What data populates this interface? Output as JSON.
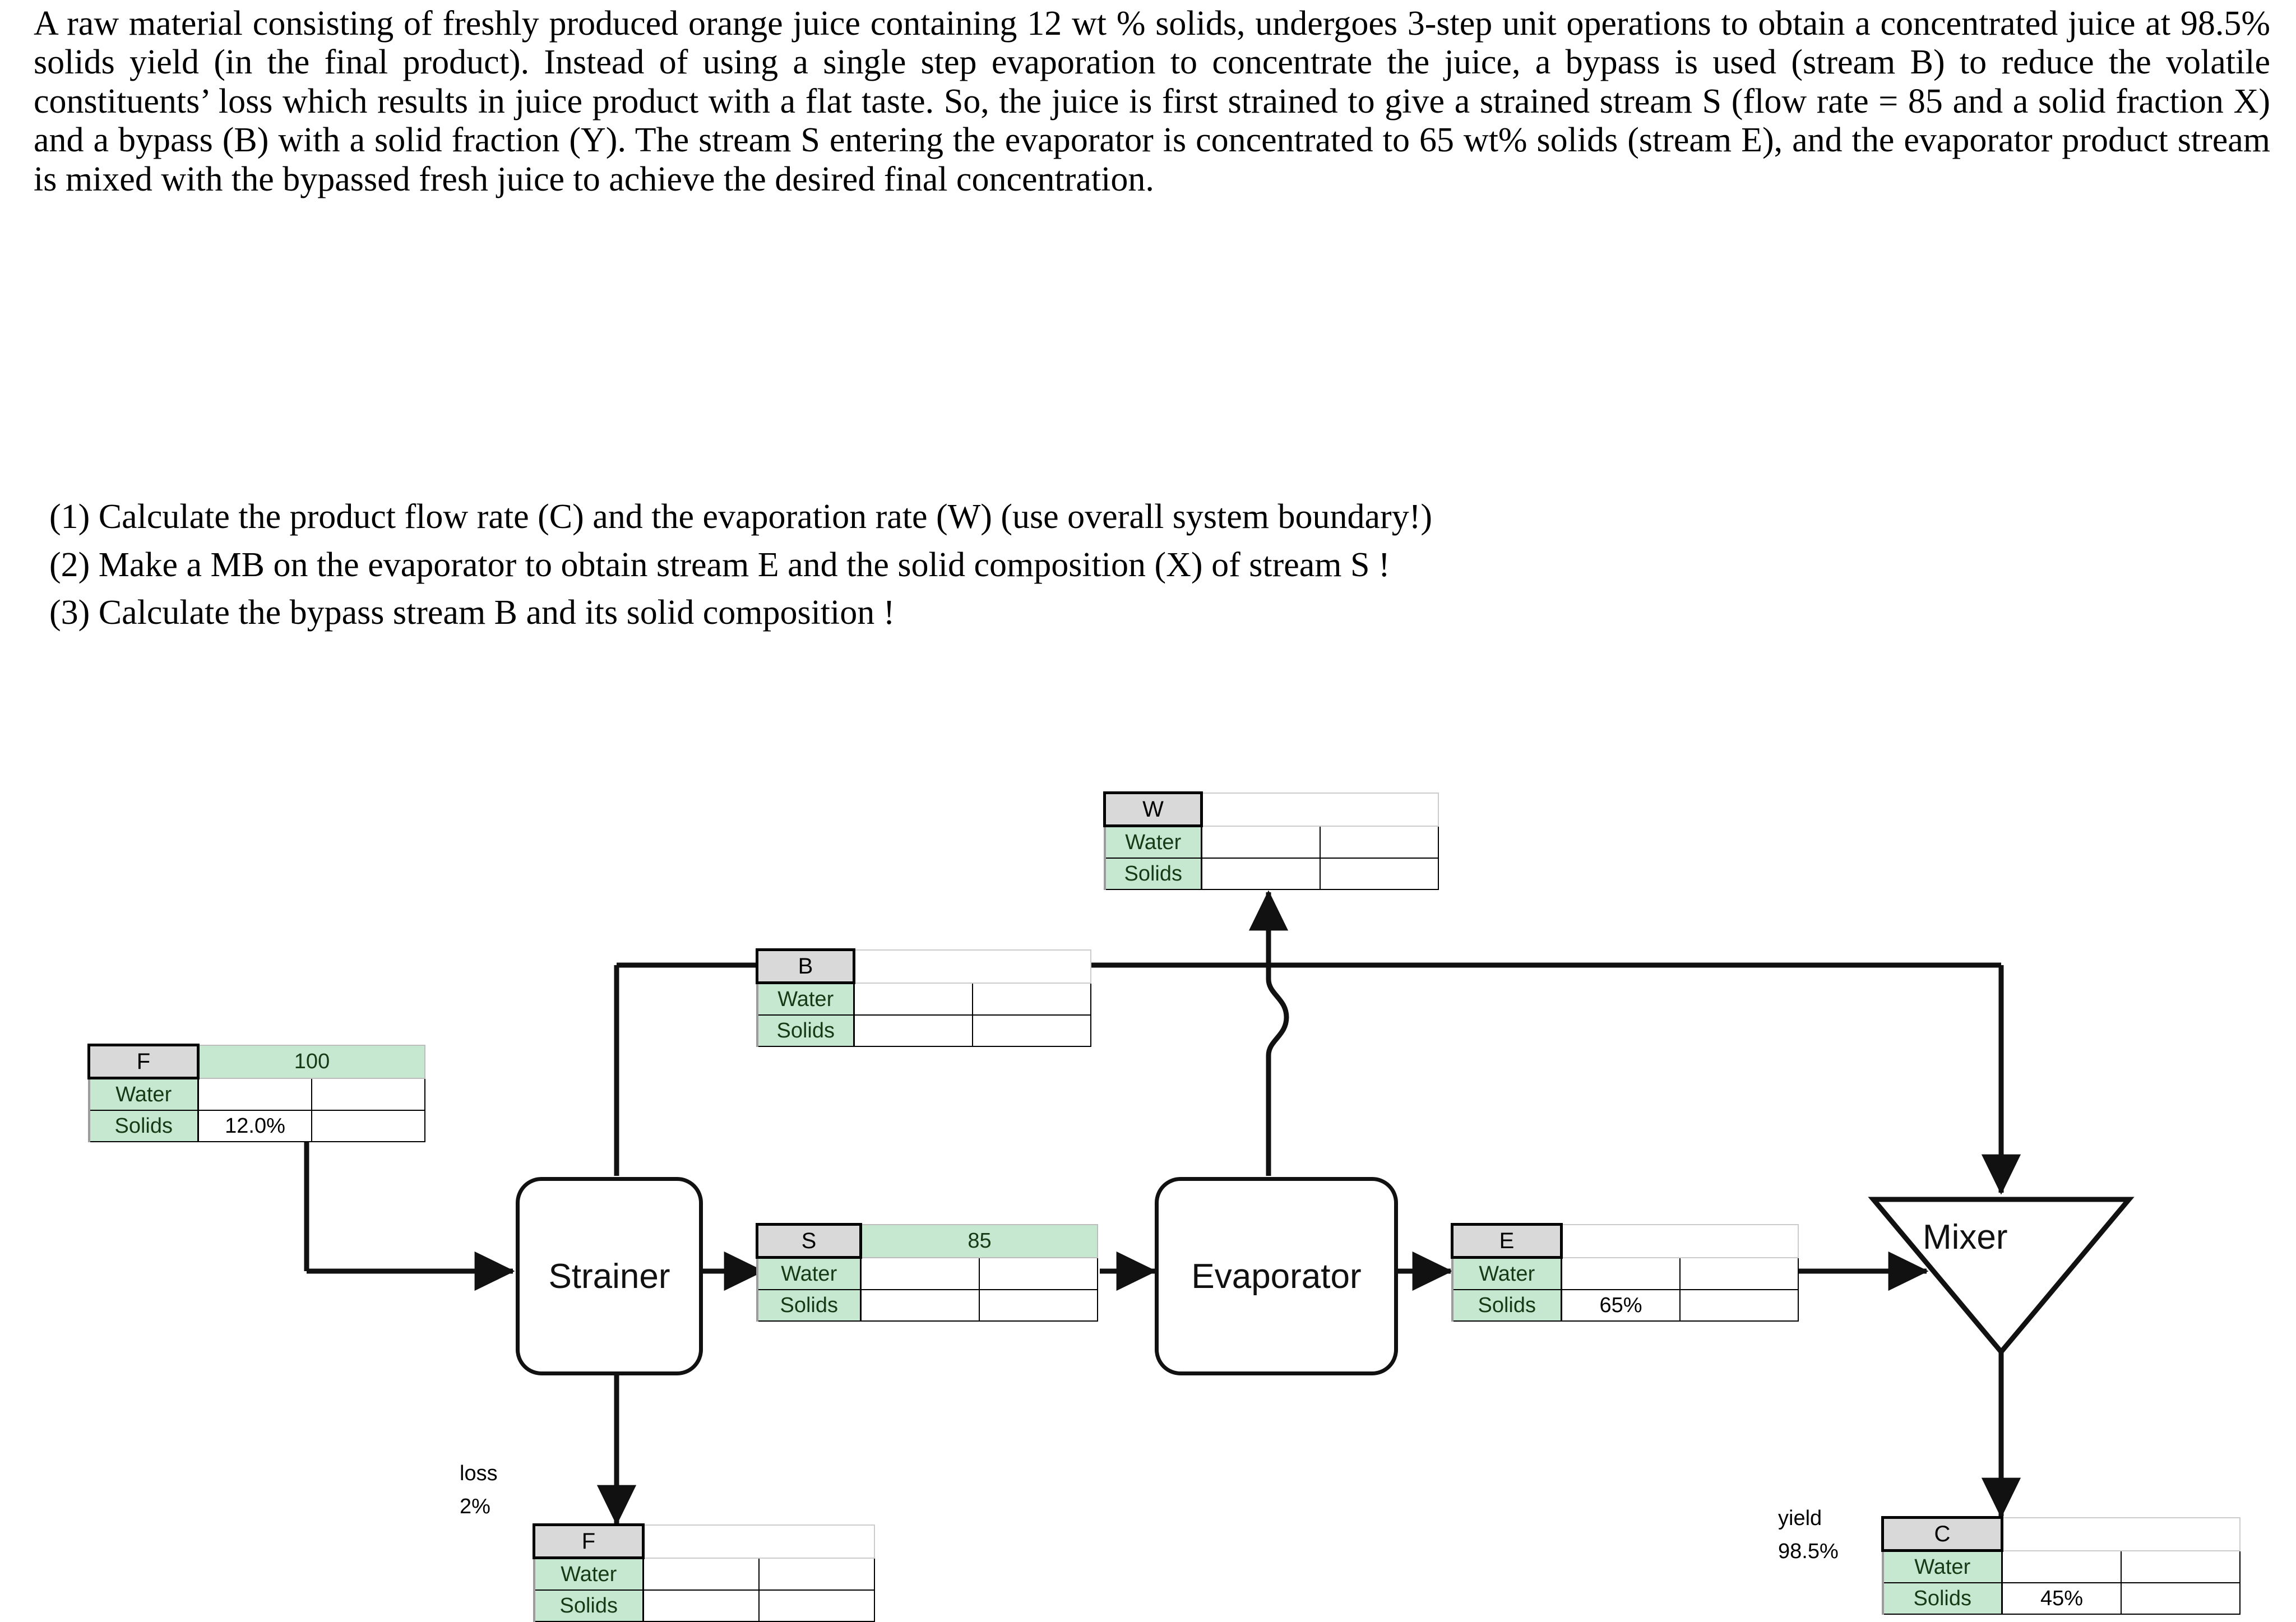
{
  "statement": {
    "paragraph": "A raw material consisting of freshly produced orange juice containing 12 wt % solids, undergoes 3-step unit operations to obtain a concentrated juice at 98.5% solids yield (in the final product).  Instead of using a single step evaporation to concentrate the juice, a bypass is used (stream B) to reduce the volatile constituents’ loss which results in juice product with a flat taste.  So, the juice is first strained to give a strained stream S (flow rate = 85 and a solid fraction X) and a bypass (B) with a solid fraction (Y). The stream S entering the evaporator is concentrated to 65 wt% solids (stream E), and the evaporator product stream is mixed with the bypassed fresh juice to achieve the desired final concentration."
  },
  "questions": [
    "(1) Calculate the product flow rate (C) and the evaporation rate (W) (use overall system boundary!)",
    "(2) Make a MB on the evaporator to obtain stream E and the solid composition (X) of stream S !",
    "(3) Calculate the bypass stream B and its solid composition !"
  ],
  "units": {
    "strainer": "Strainer",
    "evaporator": "Evaporator",
    "mixer": "Mixer"
  },
  "annotations": {
    "loss_label": "loss",
    "loss_value": "2%",
    "yield_label": "yield",
    "yield_value": "98.5%"
  },
  "row_labels": {
    "water": "Water",
    "solids": "Solids"
  },
  "tables": {
    "W": {
      "name": "W",
      "total": "",
      "water": {
        "c1": "",
        "c2": ""
      },
      "solids": {
        "c1": "",
        "c2": ""
      }
    },
    "B": {
      "name": "B",
      "total": "",
      "water": {
        "c1": "",
        "c2": ""
      },
      "solids": {
        "c1": "",
        "c2": ""
      }
    },
    "F_feed": {
      "name": "F",
      "total": "100",
      "water": {
        "c1": "",
        "c2": ""
      },
      "solids": {
        "c1": "12.0%",
        "c2": ""
      }
    },
    "S": {
      "name": "S",
      "total": "85",
      "water": {
        "c1": "",
        "c2": ""
      },
      "solids": {
        "c1": "",
        "c2": ""
      }
    },
    "E": {
      "name": "E",
      "total": "",
      "water": {
        "c1": "",
        "c2": ""
      },
      "solids": {
        "c1": "65%",
        "c2": ""
      }
    },
    "F_loss": {
      "name": "F",
      "total": "",
      "water": {
        "c1": "",
        "c2": ""
      },
      "solids": {
        "c1": "",
        "c2": ""
      }
    },
    "C": {
      "name": "C",
      "total": "",
      "water": {
        "c1": "",
        "c2": ""
      },
      "solids": {
        "c1": "45%",
        "c2": ""
      }
    }
  },
  "colors": {
    "header_gray": "#d9d9d9",
    "row_green": "#c6e8d0",
    "green_text": "#163a16",
    "line": "#111111"
  }
}
